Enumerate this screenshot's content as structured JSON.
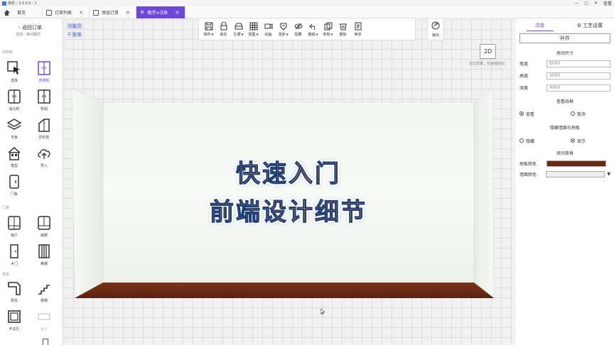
{
  "window": {
    "title": "易柜 - 3.4.0.6 - 2",
    "controls": [
      "—",
      "□",
      "✕",
      "查看"
    ]
  },
  "tabs": [
    {
      "label": "首页",
      "active": false
    },
    {
      "label": "订单列表",
      "active": false
    },
    {
      "label": "添加订单",
      "active": false
    },
    {
      "label": "教学>次卧",
      "active": true
    }
  ],
  "sidebar": {
    "back_label": "返回订单",
    "current_mode": "当前：房间模式",
    "sections": [
      "定制柜",
      "门窗",
      "建筑"
    ],
    "tools": [
      {
        "label": "选择",
        "icon": "cursor-arrow-icon"
      },
      {
        "label": "普通柜",
        "icon": "cabinet-icon"
      },
      {
        "label": "组合柜",
        "icon": "combo-cabinet-icon"
      },
      {
        "label": "柜组",
        "icon": "cabinet-group-icon"
      },
      {
        "label": "平板",
        "icon": "layers-icon"
      },
      {
        "label": "异形柜",
        "icon": "irregular-cabinet-icon"
      },
      {
        "label": "模型",
        "icon": "model-house-icon"
      },
      {
        "label": "导入",
        "icon": "cloud-upload-icon"
      },
      {
        "label": "门板",
        "icon": "door-panel-icon"
      },
      {
        "label": "窗户",
        "icon": "window-icon"
      },
      {
        "label": "踢脚",
        "icon": "baseboard-icon"
      },
      {
        "label": "木门",
        "icon": "wood-door-icon"
      },
      {
        "label": "格栅",
        "icon": "grille-icon"
      },
      {
        "label": "梁柱",
        "icon": "beam-icon"
      },
      {
        "label": "楼梯",
        "icon": "stairs-icon"
      },
      {
        "label": "开关孔",
        "icon": "switch-hole-icon"
      },
      {
        "label": "盖子",
        "icon": "cover-icon"
      }
    ]
  },
  "canvas": {
    "links": [
      "测量图",
      "千里眼"
    ],
    "toolbar": [
      {
        "label": "保存",
        "icon": "save-icon",
        "dropdown": true
      },
      {
        "label": "锁定",
        "icon": "lock-icon",
        "dropdown": false
      },
      {
        "label": "孔槽",
        "icon": "hole-slot-icon",
        "dropdown": true
      },
      {
        "label": "视图",
        "icon": "grid-view-icon",
        "dropdown": true
      },
      {
        "label": "动画",
        "icon": "video-icon",
        "dropdown": false
      },
      {
        "label": "渲染",
        "icon": "render-icon",
        "dropdown": true
      },
      {
        "label": "隐藏",
        "icon": "eye-hide-icon",
        "dropdown": false
      },
      {
        "label": "撤销",
        "icon": "undo-icon",
        "dropdown": true
      },
      {
        "label": "复制",
        "icon": "copy-icon",
        "dropdown": true
      },
      {
        "label": "删除",
        "icon": "trash-icon",
        "dropdown": false
      },
      {
        "label": "审单",
        "icon": "review-doc-icon",
        "dropdown": false
      }
    ],
    "export_label": "输出",
    "view_2d_label": "2D",
    "hint": "双击屏幕，快速缩放SC",
    "overlay_line1": "快速入门",
    "overlay_line2": "前端设计细节"
  },
  "panel": {
    "tabs": [
      {
        "label": "次卧",
        "active": true
      },
      {
        "label": "工艺设置",
        "active": false
      }
    ],
    "supplement_label": "补件",
    "room_size_title": "房间尺寸",
    "width": {
      "label": "宽度",
      "value": "6000"
    },
    "height": {
      "label": "高度",
      "value": "3000"
    },
    "depth": {
      "label": "深度",
      "value": "4000"
    },
    "wireframe_title": "查看线框",
    "wireframe_view": "查看",
    "wireframe_cancel": "取消",
    "hide_walls_title": "隐藏墙面与地板",
    "hide_label": "隐藏",
    "show_label": "显示",
    "background_title": "房间背景",
    "floor_color_label": "地板颜色",
    "wall_color_label": "墙面颜色",
    "floor_color": "#6a2a14",
    "wall_color": "#eeeeee"
  },
  "colors": {
    "accent": "#6d47d9",
    "overlay_fill": "#ff7a2a",
    "overlay_stroke": "#1c3f7a"
  }
}
